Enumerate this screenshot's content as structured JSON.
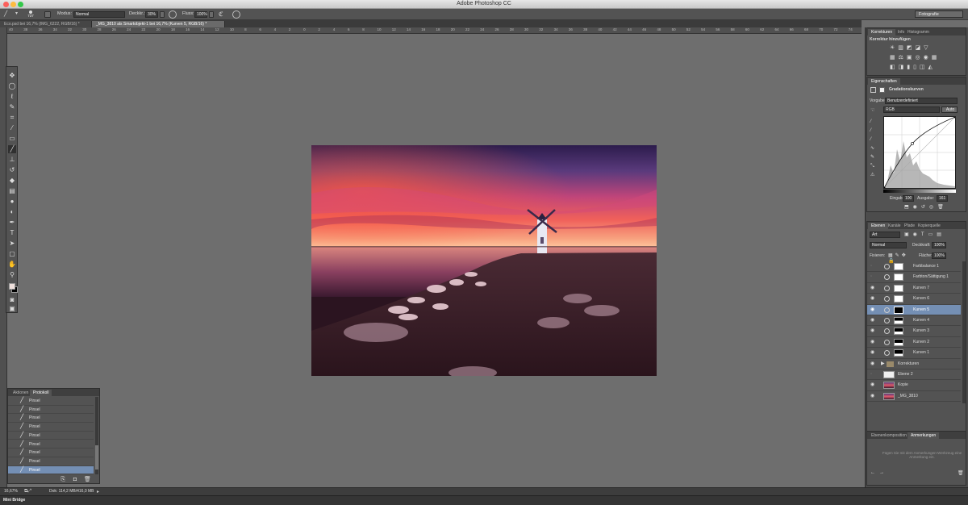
{
  "app": {
    "title": "Adobe Photoshop CC"
  },
  "options": {
    "mode_label": "Modus:",
    "mode_value": "Normal",
    "opacity_label": "Deckkr.:",
    "opacity_value": "30%",
    "flow_label": "Fluss:",
    "flow_value": "100%",
    "brush_size": "737",
    "workspace": "Fotografie"
  },
  "tabs": [
    {
      "label": "Eco.psd bei 16,7% (IMG_6222, RGB/16) *"
    },
    {
      "label": "_MG_3810 als Smartobjekt-1 bei 16,7% (Kurven 5, RGB/16) *"
    }
  ],
  "ruler": {
    "h_ticks": [
      "40",
      "38",
      "36",
      "34",
      "32",
      "30",
      "28",
      "26",
      "24",
      "22",
      "20",
      "18",
      "16",
      "14",
      "12",
      "10",
      "8",
      "6",
      "4",
      "2",
      "0",
      "2",
      "4",
      "6",
      "8",
      "10",
      "12",
      "14",
      "16",
      "18",
      "20",
      "22",
      "24",
      "26",
      "28",
      "30",
      "32",
      "34",
      "36",
      "38",
      "40",
      "42",
      "44",
      "46",
      "48",
      "50",
      "52",
      "54",
      "56",
      "58",
      "60",
      "62",
      "64",
      "66",
      "68",
      "70",
      "72",
      "74"
    ]
  },
  "history": {
    "tabs": [
      "Aktionen",
      "Protokoll"
    ],
    "items": [
      "Pinsel",
      "Pinsel",
      "Pinsel",
      "Pinsel",
      "Pinsel",
      "Pinsel",
      "Pinsel",
      "Pinsel",
      "Pinsel"
    ]
  },
  "status": {
    "zoom": "16,67%",
    "doc": "Dok: 114,2 MB/416,0 MB"
  },
  "minibridge": {
    "label": "Mini Bridge"
  },
  "adjustments": {
    "tabs": [
      "Korrekturen",
      "Info",
      "Histogramm"
    ],
    "heading": "Korrektur hinzufügen"
  },
  "properties": {
    "tab": "Eigenschaften",
    "title": "Gradationskurven",
    "preset_label": "Vorgabe:",
    "preset_value": "Benutzerdefiniert",
    "channel": "RGB",
    "auto": "Auto",
    "input_label": "Eingabe:",
    "input_value": "100",
    "output_label": "Ausgabe:",
    "output_value": "161"
  },
  "layers_panel": {
    "tabs": [
      "Ebenen",
      "Kanäle",
      "Pfade",
      "Kopierquelle"
    ],
    "kind": "Art",
    "blend": "Normal",
    "opacity_label": "Deckkraft:",
    "opacity_value": "100%",
    "fix_label": "Fixieren:",
    "fill_label": "Fläche:",
    "fill_value": "100%",
    "layers": [
      {
        "name": "Farbbalance 1"
      },
      {
        "name": "Farbton/Sättigung 1"
      },
      {
        "name": "Kurven 7"
      },
      {
        "name": "Kurven 6"
      },
      {
        "name": "Kurven 5"
      },
      {
        "name": "Kurven 4"
      },
      {
        "name": "Kurven 3"
      },
      {
        "name": "Kurven 2"
      },
      {
        "name": "Kurven 1"
      },
      {
        "name": "Korrekturen"
      },
      {
        "name": "Ebene 2"
      },
      {
        "name": "Kopie"
      },
      {
        "name": "_MG_3810"
      }
    ]
  },
  "notes": {
    "tabs": [
      "Ebenenkomposition",
      "Anmerkungen"
    ],
    "text": "Fügen Sie mit dem Anmerkungen-Werkzeug eine Anmerkung ein."
  },
  "colors": {
    "accent": "#748fb4",
    "panel": "#535353",
    "workspace": "#6e6e6e"
  }
}
